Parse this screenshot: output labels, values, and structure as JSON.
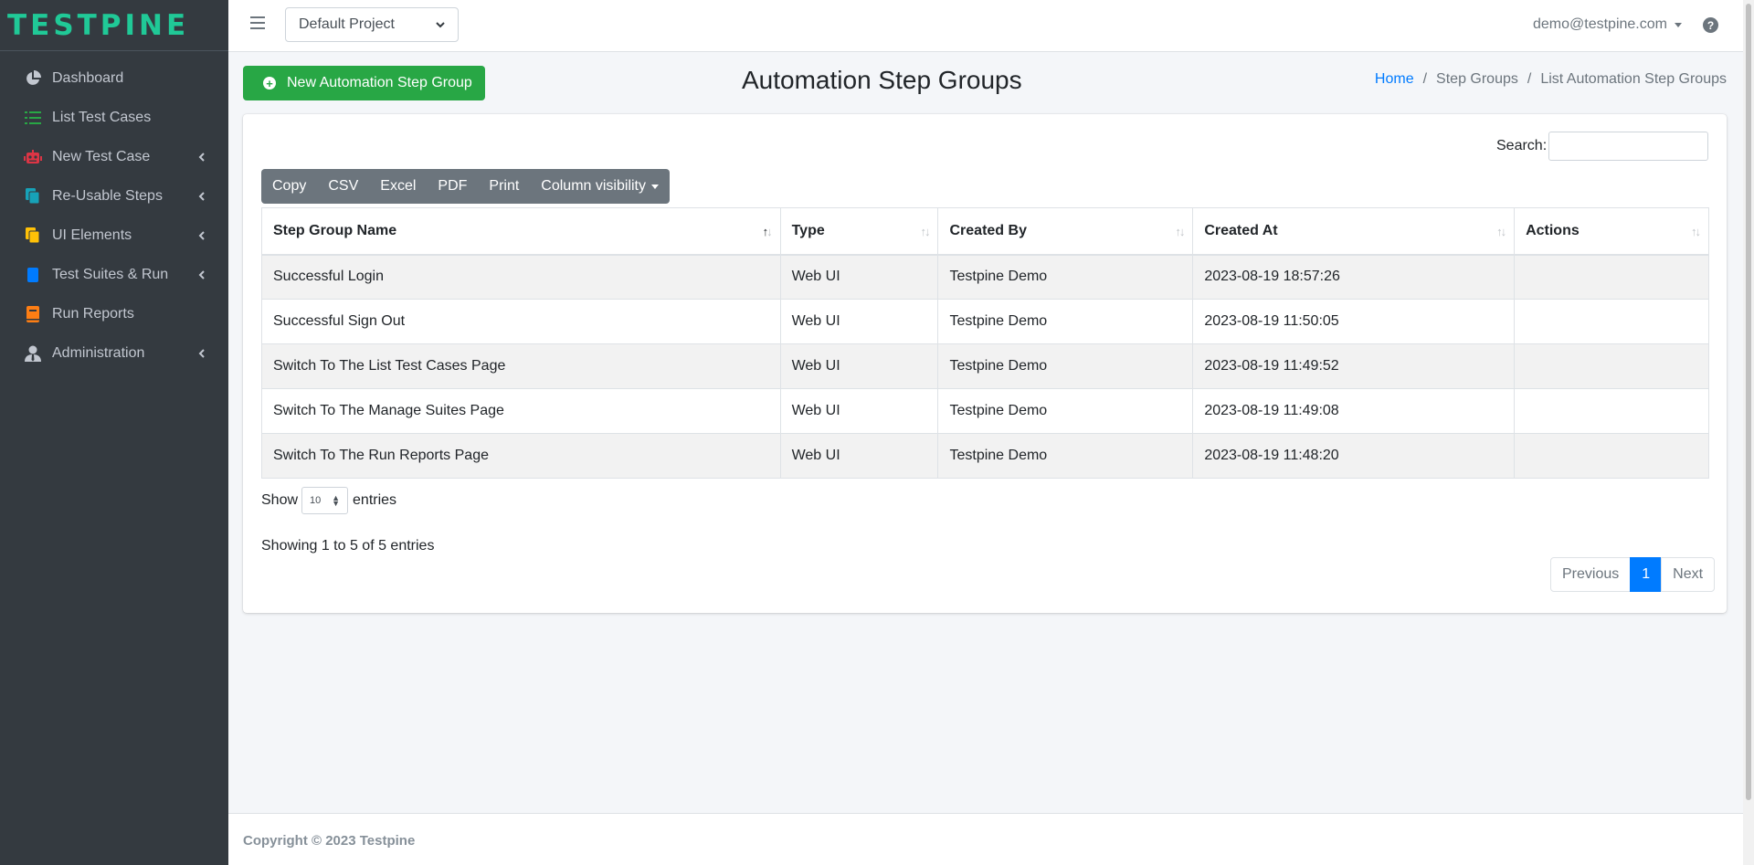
{
  "brand": {
    "name": "TESTPINE",
    "color": "#20c997"
  },
  "sidebar": {
    "items": [
      {
        "label": "Dashboard",
        "icon": "pie-chart-icon",
        "has_submenu": false
      },
      {
        "label": "List Test Cases",
        "icon": "list-icon",
        "has_submenu": false
      },
      {
        "label": "New Test Case",
        "icon": "robot-icon",
        "has_submenu": true
      },
      {
        "label": "Re-Usable Steps",
        "icon": "copy-icon",
        "has_submenu": true
      },
      {
        "label": "UI Elements",
        "icon": "files-icon",
        "has_submenu": true
      },
      {
        "label": "Test Suites & Run",
        "icon": "cube-icon",
        "has_submenu": true
      },
      {
        "label": "Run Reports",
        "icon": "book-icon",
        "has_submenu": false
      },
      {
        "label": "Administration",
        "icon": "user-tie-icon",
        "has_submenu": true
      }
    ]
  },
  "topbar": {
    "project": "Default Project",
    "user": "demo@testpine.com",
    "help": "?"
  },
  "header": {
    "new_button": "New Automation Step Group",
    "title": "Automation Step Groups",
    "breadcrumb": {
      "home": "Home",
      "step_groups": "Step Groups",
      "current": "List Automation Step Groups"
    }
  },
  "toolbar": {
    "search_label": "Search:",
    "search_value": "",
    "buttons": {
      "copy": "Copy",
      "csv": "CSV",
      "excel": "Excel",
      "pdf": "PDF",
      "print": "Print",
      "column_visibility": "Column visibility"
    }
  },
  "table": {
    "columns": [
      "Step Group Name",
      "Type",
      "Created By",
      "Created At",
      "Actions"
    ],
    "rows": [
      [
        "Successful Login",
        "Web UI",
        "Testpine Demo",
        "2023-08-19 18:57:26",
        ""
      ],
      [
        "Successful Sign Out",
        "Web UI",
        "Testpine Demo",
        "2023-08-19 11:50:05",
        ""
      ],
      [
        "Switch To The List Test Cases Page",
        "Web UI",
        "Testpine Demo",
        "2023-08-19 11:49:52",
        ""
      ],
      [
        "Switch To The Manage Suites Page",
        "Web UI",
        "Testpine Demo",
        "2023-08-19 11:49:08",
        ""
      ],
      [
        "Switch To The Run Reports Page",
        "Web UI",
        "Testpine Demo",
        "2023-08-19 11:48:20",
        ""
      ]
    ]
  },
  "length": {
    "show": "Show",
    "value": "10",
    "entries": "entries"
  },
  "info": "Showing 1 to 5 of 5 entries",
  "pagination": {
    "previous": "Previous",
    "current": "1",
    "next": "Next"
  },
  "footer": "Copyright © 2023 Testpine",
  "colors": {
    "sidebar_bg": "#343a40",
    "primary": "#007bff",
    "success": "#28a745",
    "secondary": "#6c757d"
  }
}
